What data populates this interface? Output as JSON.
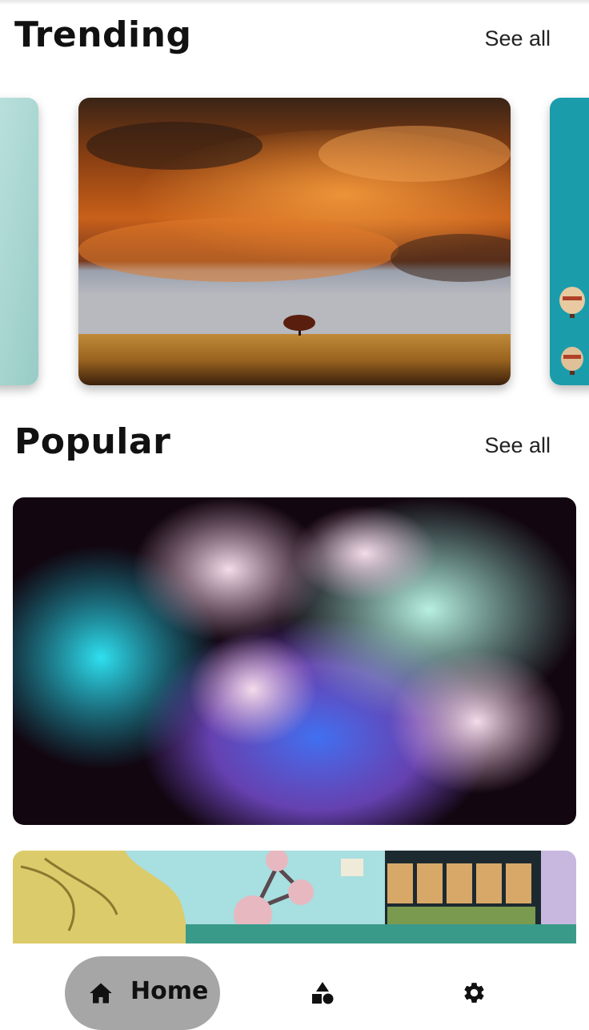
{
  "trending": {
    "title": "Trending",
    "see_all_label": "See all",
    "cards": [
      {
        "name": "teal-gradient-card",
        "icon": "partial-card"
      },
      {
        "name": "sunset-tree-field-card",
        "icon": "landscape-photo"
      },
      {
        "name": "hot-air-balloons-card",
        "icon": "balloons-photo"
      }
    ]
  },
  "popular": {
    "title": "Popular",
    "see_all_label": "See all",
    "cards": [
      {
        "name": "colored-smoke-card",
        "icon": "abstract-photo"
      },
      {
        "name": "graffiti-wall-card",
        "icon": "street-art-photo"
      }
    ]
  },
  "bottom_nav": {
    "items": [
      {
        "label": "Home",
        "icon": "home-icon",
        "active": true
      },
      {
        "label": "",
        "icon": "categories-icon",
        "active": false
      },
      {
        "label": "",
        "icon": "settings-icon",
        "active": false
      }
    ],
    "active_pill_color": "#a6a6a6"
  }
}
